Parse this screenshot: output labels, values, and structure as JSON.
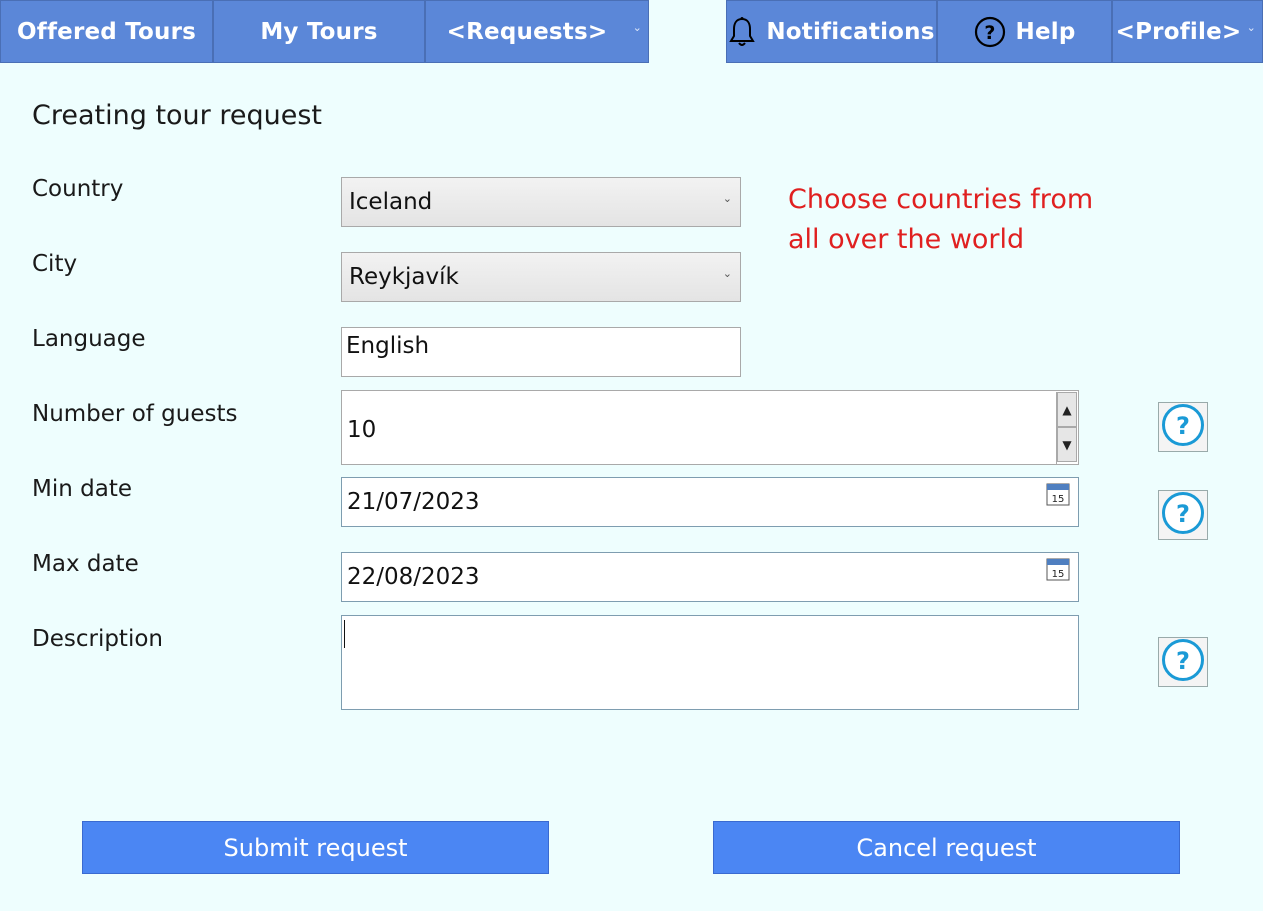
{
  "nav": {
    "tabs": [
      {
        "label": "Offered Tours"
      },
      {
        "label": "My Tours"
      },
      {
        "label": "<Requests>"
      },
      {
        "label": "Notifications",
        "icon": "bell-icon"
      },
      {
        "label": "Help",
        "icon": "question-circle-icon"
      },
      {
        "label": "<Profile>"
      }
    ]
  },
  "form": {
    "title": "Creating tour request",
    "country": {
      "label": "Country",
      "value": "Iceland"
    },
    "city": {
      "label": "City",
      "value": "Reykjavík"
    },
    "language": {
      "label": "Language",
      "value": "English"
    },
    "guests": {
      "label": "Number of guests",
      "value": "10"
    },
    "min_date": {
      "label": "Min date",
      "value": "21/07/2023"
    },
    "max_date": {
      "label": "Max date",
      "value": "22/08/2023"
    },
    "description": {
      "label": "Description",
      "value": ""
    },
    "calendar_day": "15",
    "hint": [
      "Choose countries from",
      "all over the world"
    ]
  },
  "buttons": {
    "submit": "Submit request",
    "cancel": "Cancel request"
  },
  "colors": {
    "background": "#eefefe",
    "tab": "#5b87d8",
    "button": "#4b86f3",
    "hint": "#e02020"
  }
}
